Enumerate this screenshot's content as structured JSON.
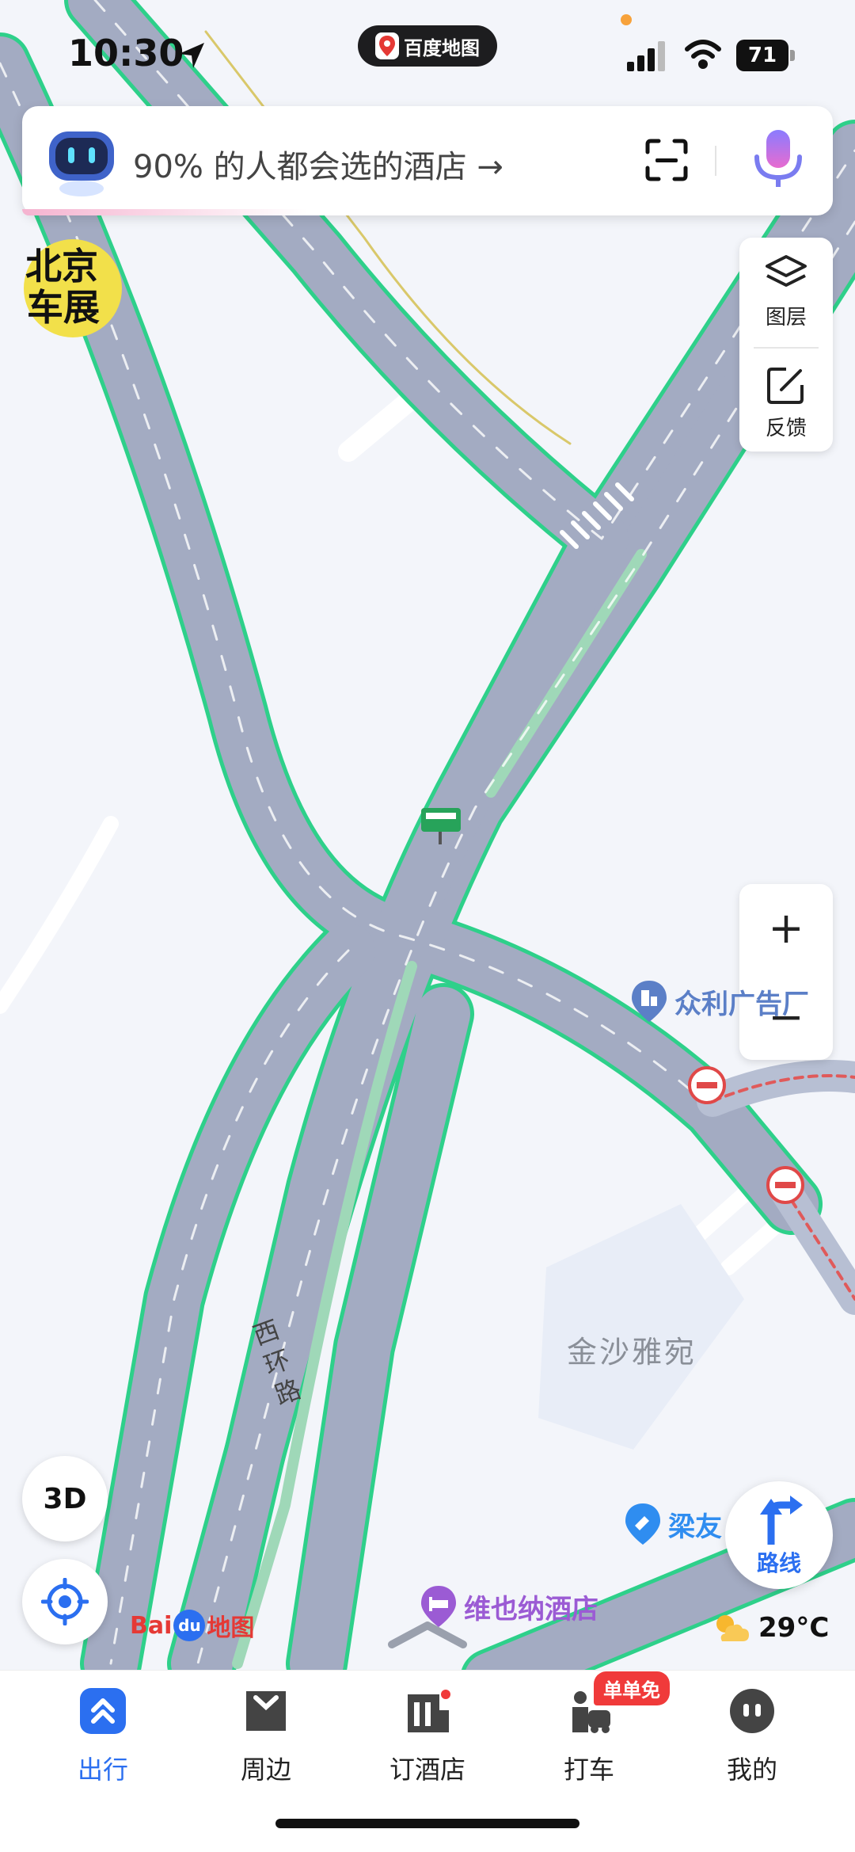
{
  "status": {
    "time": "10:30",
    "app_pill": "百度地图",
    "battery": "71"
  },
  "search": {
    "placeholder": "90% 的人都会选的酒店 →"
  },
  "promo": {
    "line1": "北京",
    "line2": "车展"
  },
  "layer_panel": {
    "layers_label": "图层",
    "feedback_label": "反馈"
  },
  "zoom": {
    "in": "+",
    "out": "−"
  },
  "map": {
    "pois": [
      {
        "name": "众利广告厂",
        "color": "#5b7fc7"
      },
      {
        "name": "梁友",
        "color": "#2f8df0"
      },
      {
        "name": "维也纳酒店",
        "color": "#9b5bd4"
      }
    ],
    "area": "金沙雅宛",
    "road": "西环路"
  },
  "controls": {
    "btn_3d": "3D",
    "route": "路线"
  },
  "logo": {
    "bai": "Bai",
    "du": "du",
    "ditu": "地图"
  },
  "weather": {
    "temp": "29°C"
  },
  "tabs": [
    {
      "label": "出行",
      "icon": "travel-icon",
      "active": true
    },
    {
      "label": "周边",
      "icon": "nearby-icon"
    },
    {
      "label": "订酒店",
      "icon": "hotel-icon"
    },
    {
      "label": "打车",
      "icon": "taxi-icon"
    },
    {
      "label": "我的",
      "icon": "profile-icon"
    }
  ],
  "taxi_badge": "单单免",
  "colors": {
    "accent": "#2b6ff0",
    "road": "#a3abc2",
    "road_edge": "#2ed08a",
    "background": "#f3f5fa"
  }
}
